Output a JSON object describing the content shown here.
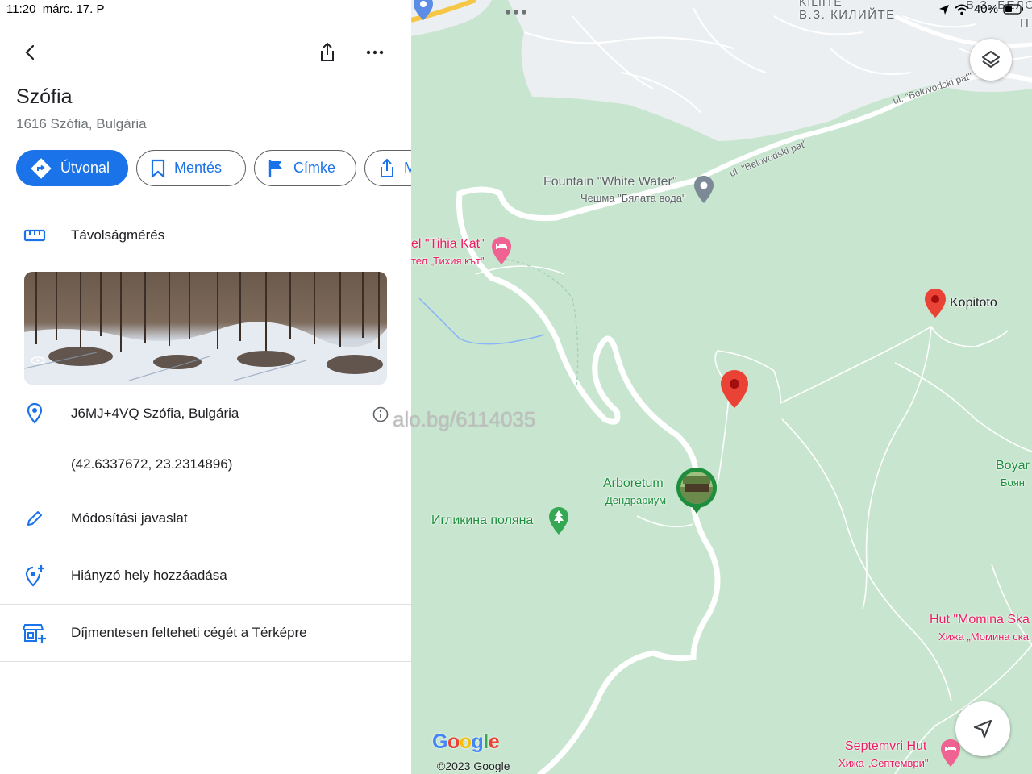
{
  "status": {
    "time": "11:20",
    "date": "márc. 17. P",
    "battery": "40%"
  },
  "place": {
    "title": "Szófia",
    "address": "1616 Szófia, Bulgária"
  },
  "actions": {
    "directions": "Útvonal",
    "save": "Mentés",
    "label": "Címke",
    "share_partial": "M"
  },
  "rows": {
    "measure": "Távolságmérés",
    "pluscode": "J6MJ+4VQ Szófia, Bulgária",
    "coords": "(42.6337672, 23.2314896)",
    "suggest_edit": "Módosítási javaslat",
    "add_missing": "Hiányzó hely hozzáadása",
    "add_business": "Díjmentesen felteheti cégét a Térképre"
  },
  "map": {
    "district_1": "В.З. КИЛИЙТЕ",
    "district_1_top": "KILIITE",
    "district_2": "В.З. БЕЛО",
    "district_2b": "П",
    "road_1": "ul. \"Belovodski pat\"",
    "road_2": "ul. \"Belovodski pat\"",
    "fountain": "Fountain \"White Water\"",
    "fountain_bg": "Чешма \"Бялата вода\"",
    "hotel": "el \"Tihia Kat\"",
    "hotel_bg": "тел „Тихия кът\"",
    "kopitoto": "Kopitoto",
    "arboretum": "Arboretum",
    "arboretum_bg": "Дендрариум",
    "iglikina": "Игликина поляна",
    "boyana": "Boyar",
    "boyana_bg": "Боян",
    "momina": "Hut \"Momina Ska",
    "momina_bg": "Хижа „Момина ска",
    "septemvri": "Septemvri Hut",
    "septemvri_bg": "Хижа „Септември\"",
    "google": "Google",
    "copyright": "©2023 Google"
  },
  "watermark": "alo.bg/6114035",
  "colors": {
    "accent": "#1a73e8",
    "map_green": "#c8e6cf",
    "pin_red": "#ea4335",
    "poi_pink": "#e91e63",
    "park_green": "#1e8e3e"
  }
}
